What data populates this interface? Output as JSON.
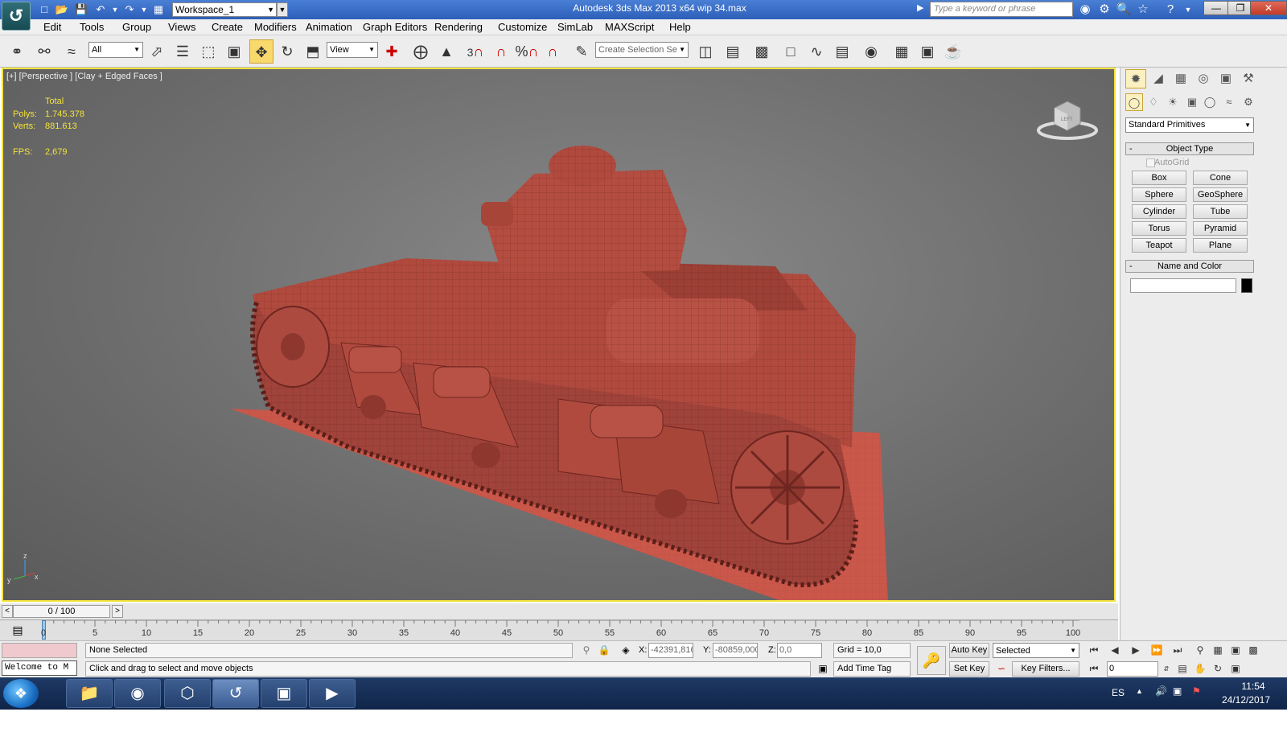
{
  "titlebar": {
    "title": "Autodesk 3ds Max  2013 x64     wip 34.max",
    "workspace": "Workspace_1",
    "search_placeholder": "Type a keyword or phrase"
  },
  "menu": [
    "Edit",
    "Tools",
    "Group",
    "Views",
    "Create",
    "Modifiers",
    "Animation",
    "Graph Editors",
    "Rendering",
    "Customize",
    "SimLab",
    "MAXScript",
    "Help"
  ],
  "toolbar": {
    "selection_filter": "All",
    "reference_coord": "View",
    "named_selection_placeholder": "Create Selection Se",
    "snap_value": "3"
  },
  "viewport": {
    "label": "[+] [Perspective ] [Clay + Edged Faces ]",
    "stats_header": "Total",
    "polys_label": "Polys:",
    "polys_value": "1.745.378",
    "verts_label": "Verts:",
    "verts_value": "881.613",
    "fps_label": "FPS:",
    "fps_value": "2,679",
    "viewcube_face": "LEFT",
    "axis_z": "z",
    "axis_y": "y",
    "axis_x": "x",
    "model_color": "#b04a3e",
    "ground_color": "#c9574a"
  },
  "command_panel": {
    "primitive_type": "Standard Primitives",
    "object_type_rollout": "Object Type",
    "autogrid": "AutoGrid",
    "buttons": [
      "Box",
      "Cone",
      "Sphere",
      "GeoSphere",
      "Cylinder",
      "Tube",
      "Torus",
      "Pyramid",
      "Teapot",
      "Plane"
    ],
    "name_color_rollout": "Name and Color",
    "name_value": "",
    "color_swatch": "#000000"
  },
  "timeline": {
    "slider_text": "0 / 100",
    "prev": "<",
    "next": ">",
    "ticks": [
      "0",
      "5",
      "10",
      "15",
      "20",
      "25",
      "30",
      "35",
      "40",
      "45",
      "50",
      "55",
      "60",
      "65",
      "70",
      "75",
      "80",
      "85",
      "90",
      "95",
      "100"
    ]
  },
  "status": {
    "listener_text": "Welcome to M",
    "selection": "None Selected",
    "prompt": "Click and drag to select and move objects",
    "x_label": "X:",
    "x_value": "-42391,816",
    "y_label": "Y:",
    "y_value": "-80859,000",
    "z_label": "Z:",
    "z_value": "0,0",
    "grid": "Grid = 10,0",
    "add_time_tag": "Add Time Tag",
    "auto_key": "Auto Key",
    "set_key": "Set Key",
    "key_mode": "Selected",
    "key_filters": "Key Filters...",
    "frame": "0"
  },
  "taskbar": {
    "lang": "ES",
    "time": "11:54",
    "date": "24/12/2017"
  }
}
